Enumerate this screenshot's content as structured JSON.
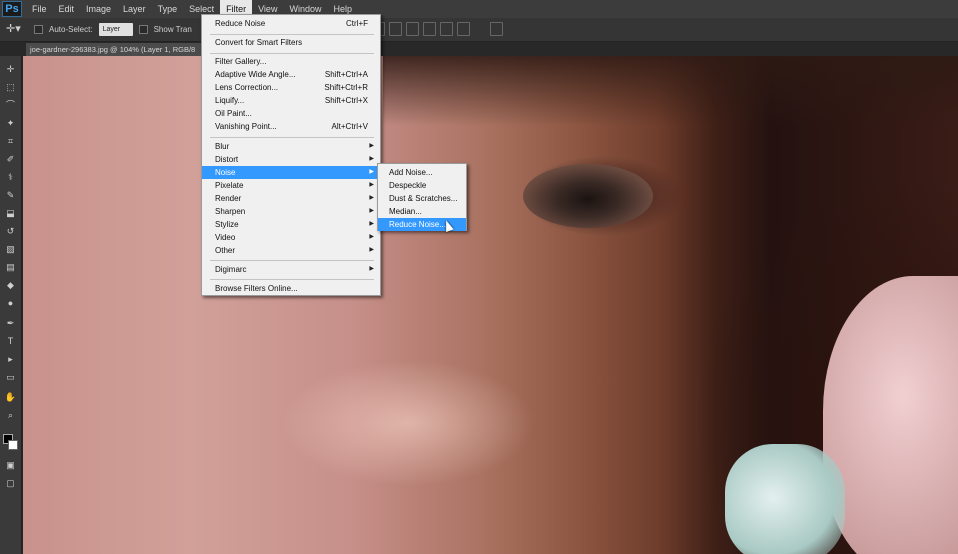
{
  "app": {
    "logo": "Ps"
  },
  "menubar": {
    "items": [
      "File",
      "Edit",
      "Image",
      "Layer",
      "Type",
      "Select",
      "Filter",
      "View",
      "Window",
      "Help"
    ],
    "active": "Filter"
  },
  "options": {
    "auto_select_label": "Auto-Select:",
    "auto_select_value": "Layer",
    "show_transform_label": "Show Tran"
  },
  "document": {
    "tab_title": "joe-gardner-296383.jpg @ 104% (Layer 1, RGB/8"
  },
  "filter_menu": {
    "top": [
      {
        "label": "Reduce Noise",
        "shortcut": "Ctrl+F"
      }
    ],
    "smart": [
      {
        "label": "Convert for Smart Filters",
        "shortcut": ""
      }
    ],
    "gallery": [
      {
        "label": "Filter Gallery...",
        "shortcut": ""
      },
      {
        "label": "Adaptive Wide Angle...",
        "shortcut": "Shift+Ctrl+A"
      },
      {
        "label": "Lens Correction...",
        "shortcut": "Shift+Ctrl+R"
      },
      {
        "label": "Liquify...",
        "shortcut": "Shift+Ctrl+X"
      },
      {
        "label": "Oil Paint...",
        "shortcut": ""
      },
      {
        "label": "Vanishing Point...",
        "shortcut": "Alt+Ctrl+V"
      }
    ],
    "groups": [
      "Blur",
      "Distort",
      "Noise",
      "Pixelate",
      "Render",
      "Sharpen",
      "Stylize",
      "Video",
      "Other"
    ],
    "highlighted": "Noise",
    "digimarc": "Digimarc",
    "browse": "Browse Filters Online..."
  },
  "noise_submenu": {
    "items": [
      "Add Noise...",
      "Despeckle",
      "Dust & Scratches...",
      "Median...",
      "Reduce Noise..."
    ],
    "highlighted": "Reduce Noise..."
  },
  "colors": {
    "highlight": "#3399ff",
    "menubar_bg": "#3c3c3c",
    "menu_bg": "#f0f0f0"
  }
}
